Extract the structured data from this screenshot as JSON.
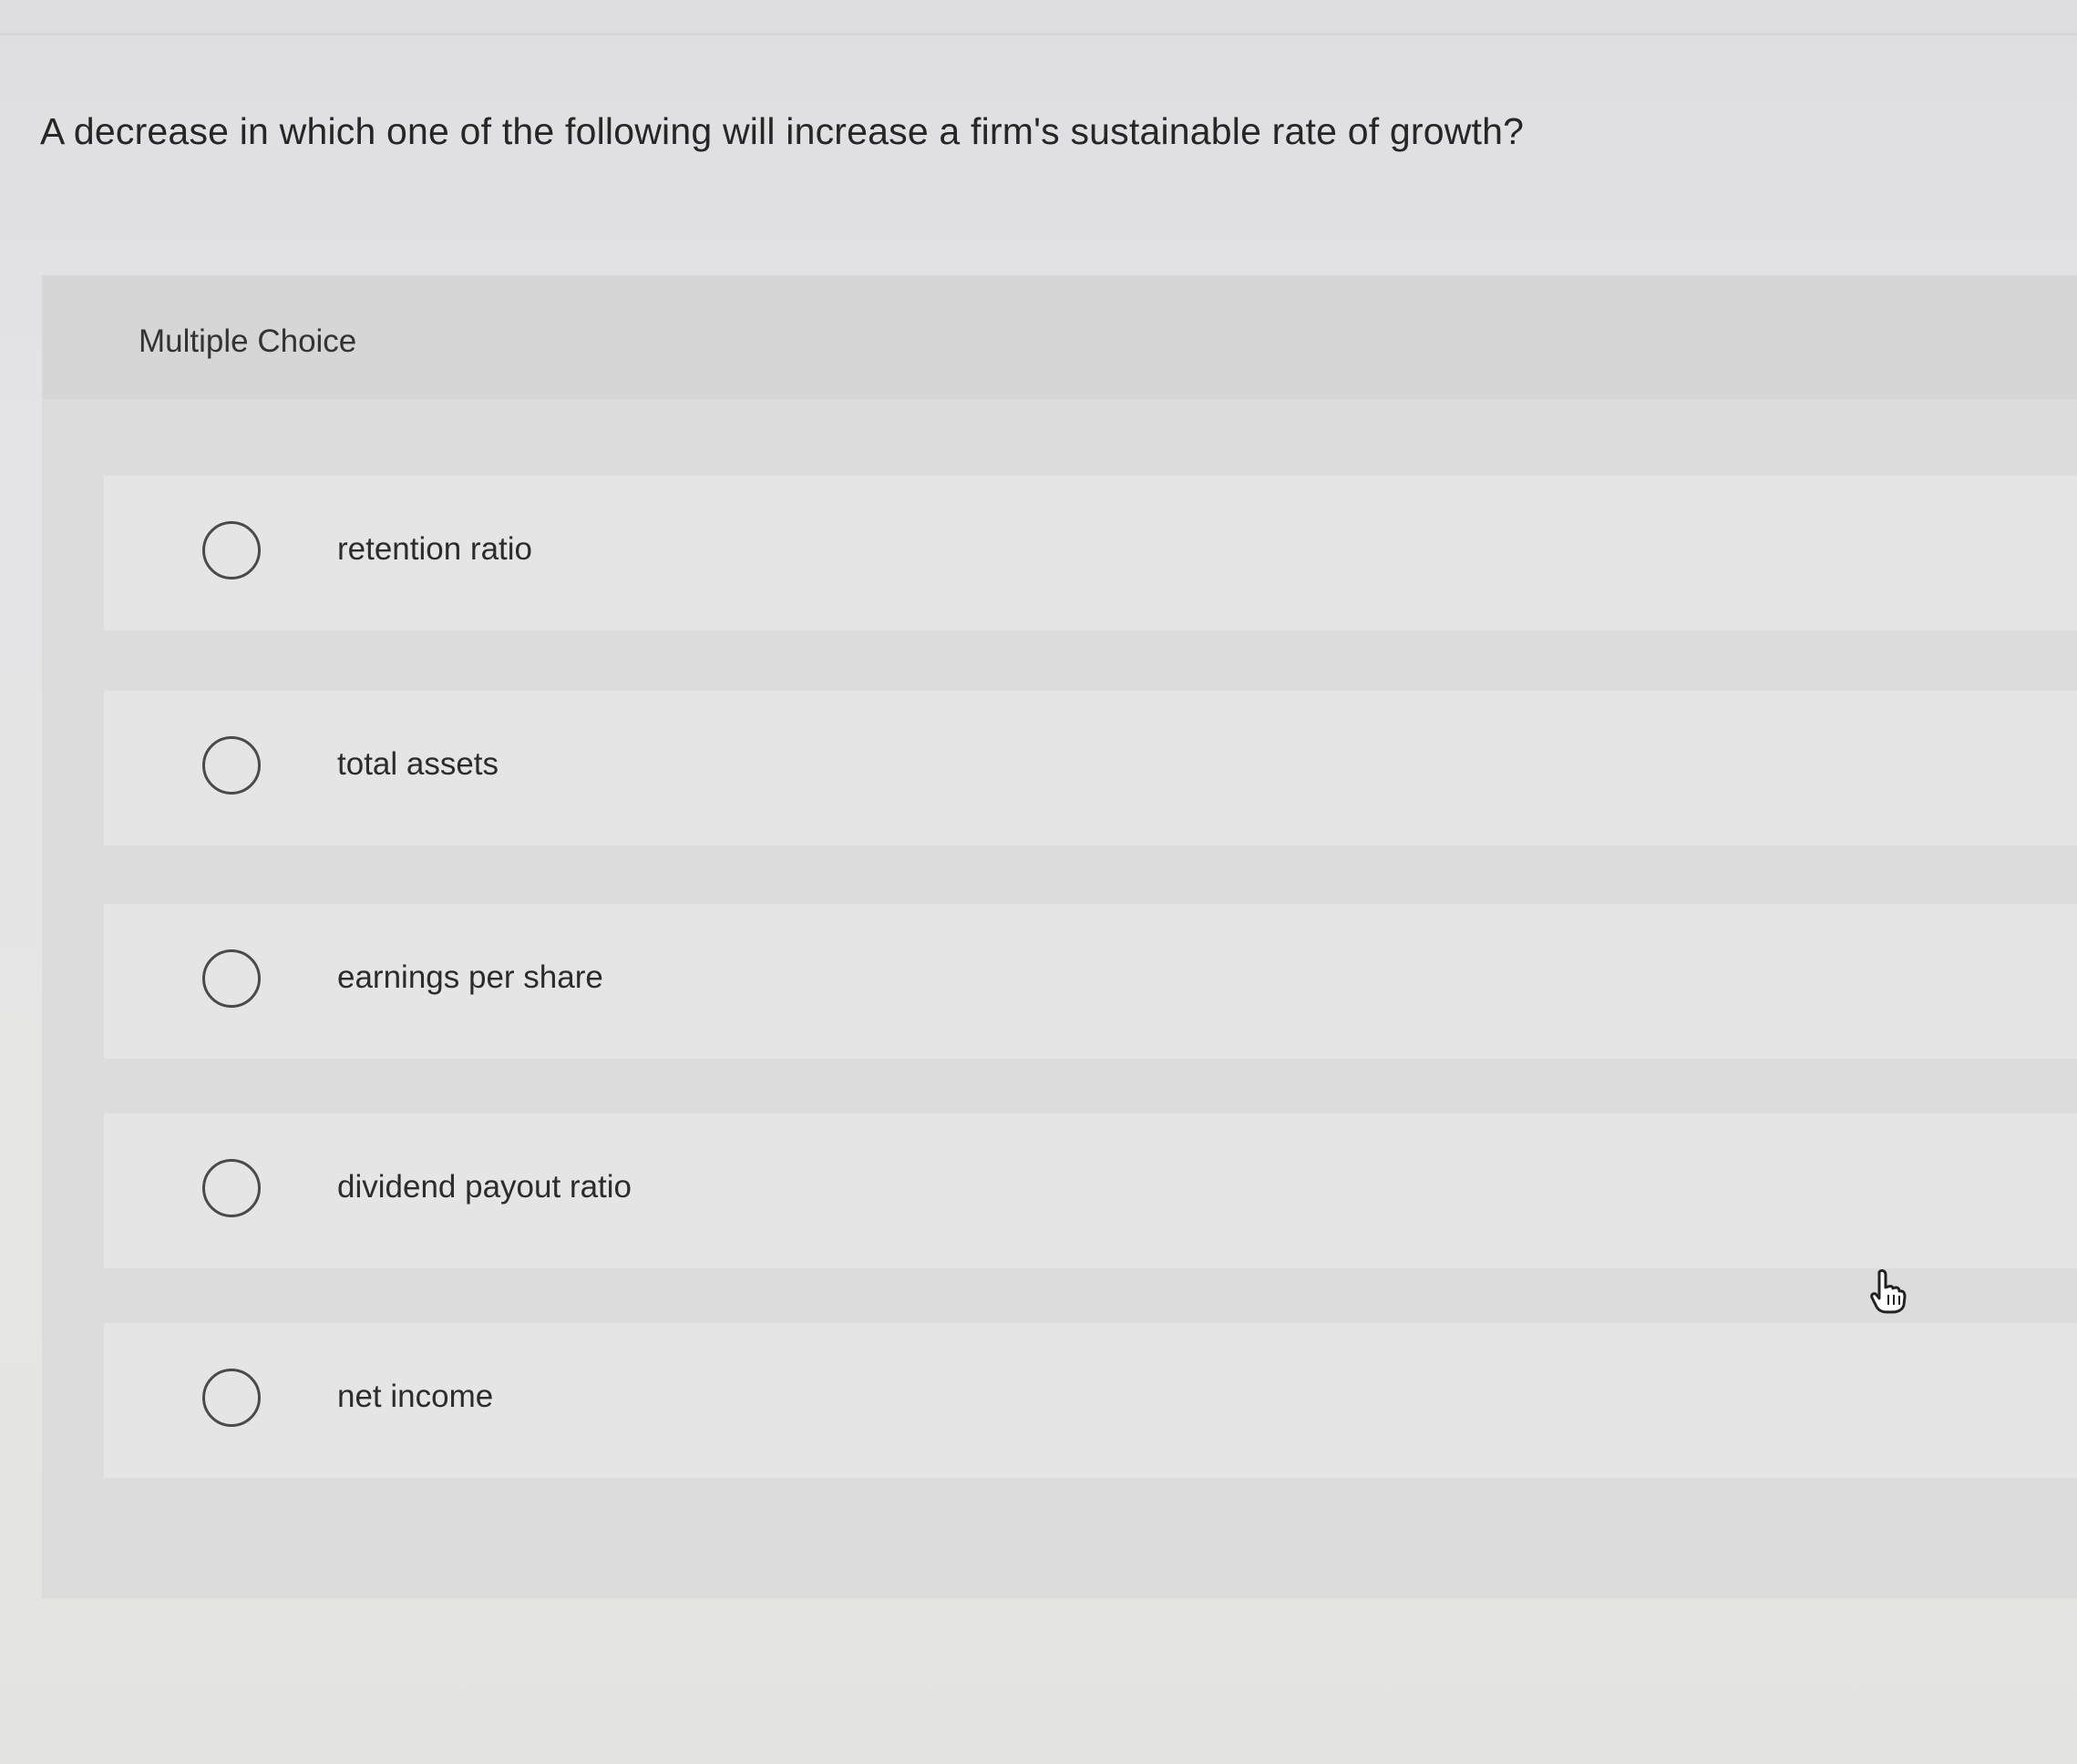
{
  "question": {
    "text": "A decrease in which one of the following will increase a firm's sustainable rate of growth?"
  },
  "multiple_choice": {
    "label": "Multiple Choice",
    "options": [
      {
        "label": "retention ratio"
      },
      {
        "label": "total assets"
      },
      {
        "label": "earnings per share"
      },
      {
        "label": "dividend payout ratio"
      },
      {
        "label": "net income"
      }
    ]
  },
  "icons": {
    "radio": "radio-button-icon",
    "cursor": "hand-pointer-icon"
  },
  "colors": {
    "text": "#262626",
    "panel": "#dcdcdc",
    "option_background": "#e5e5e5",
    "radio_border": "#4a4a4a"
  }
}
